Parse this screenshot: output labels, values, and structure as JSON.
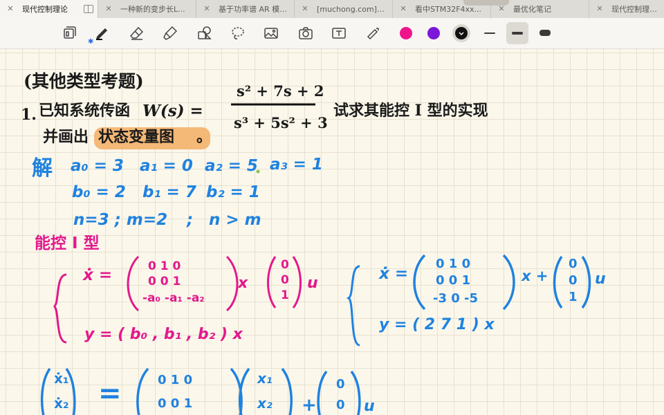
{
  "tabs": [
    {
      "label": "现代控制理论",
      "active": true
    },
    {
      "label": "一种新的变步长L..."
    },
    {
      "label": "基于功率谱 AR 模..."
    },
    {
      "label": "[muchong.com]十..."
    },
    {
      "label": "看中STM32F4xx..."
    },
    {
      "label": "最优化笔记"
    },
    {
      "label": "现代控制理论基..."
    }
  ],
  "toolbar": {
    "tools": [
      "pen-icon",
      "eraser-icon",
      "highlighter-icon",
      "shapes-icon",
      "lasso-icon",
      "image-icon",
      "camera-icon",
      "text-icon",
      "laser-pointer-icon"
    ],
    "colors": [
      "#f0148c",
      "#7a17d8",
      "#111111"
    ],
    "bluetooth": "✱"
  },
  "note": {
    "heading": "(其他类型考题)",
    "problem_num": "1.",
    "problem_text_1": "已知系统传函",
    "w_of_s": "W(s) =",
    "numerator": "s² + 7s + 2",
    "denominator": "s³ + 5s² + 3",
    "problem_text_2": "试求其能控 I 型的实现",
    "problem_text_3": "并画出",
    "highlight": "状态变量图",
    "period": "。",
    "solve": "解",
    "a_row": [
      "a₀ = 3",
      "a₁ = 0",
      "a₂ = 5",
      "a₃ = 1"
    ],
    "b_row": [
      "b₀ = 2",
      "b₁ = 7",
      "b₂ = 1"
    ],
    "n_row": [
      "n=3 ; m=2",
      ";",
      "n > m"
    ],
    "controllable_form": "能控 I 型",
    "gen_xdot": "ẋ =",
    "gen_matrix": [
      "0   1   0",
      "0   0   1",
      "-a₀  -a₁  -a₂"
    ],
    "gen_x": "x",
    "gen_b": [
      "0",
      "0",
      "1"
    ],
    "gen_u": "u",
    "gen_y": "y =  ( b₀ , b₁ , b₂ ) x",
    "num_xdot": "ẋ =",
    "num_matrix": [
      "0    1    0",
      "0    0    1",
      "-3    0   -5"
    ],
    "num_x": "x +",
    "num_b": [
      "0",
      "0",
      "1"
    ],
    "num_u": "u",
    "num_y": "y =  (   2     7    1 ) x",
    "bottom_x1dot": "ẋ₁",
    "bottom_x2dot": "ẋ₂",
    "bottom_eq": "=",
    "bottom_m_row1": "0    1    0",
    "bottom_m_row2": "0    0    1",
    "bottom_x1": "x₁",
    "bottom_x2": "x₂",
    "bottom_plus": "+",
    "bottom_b1": "0",
    "bottom_b2": "0",
    "bottom_u": "u"
  }
}
